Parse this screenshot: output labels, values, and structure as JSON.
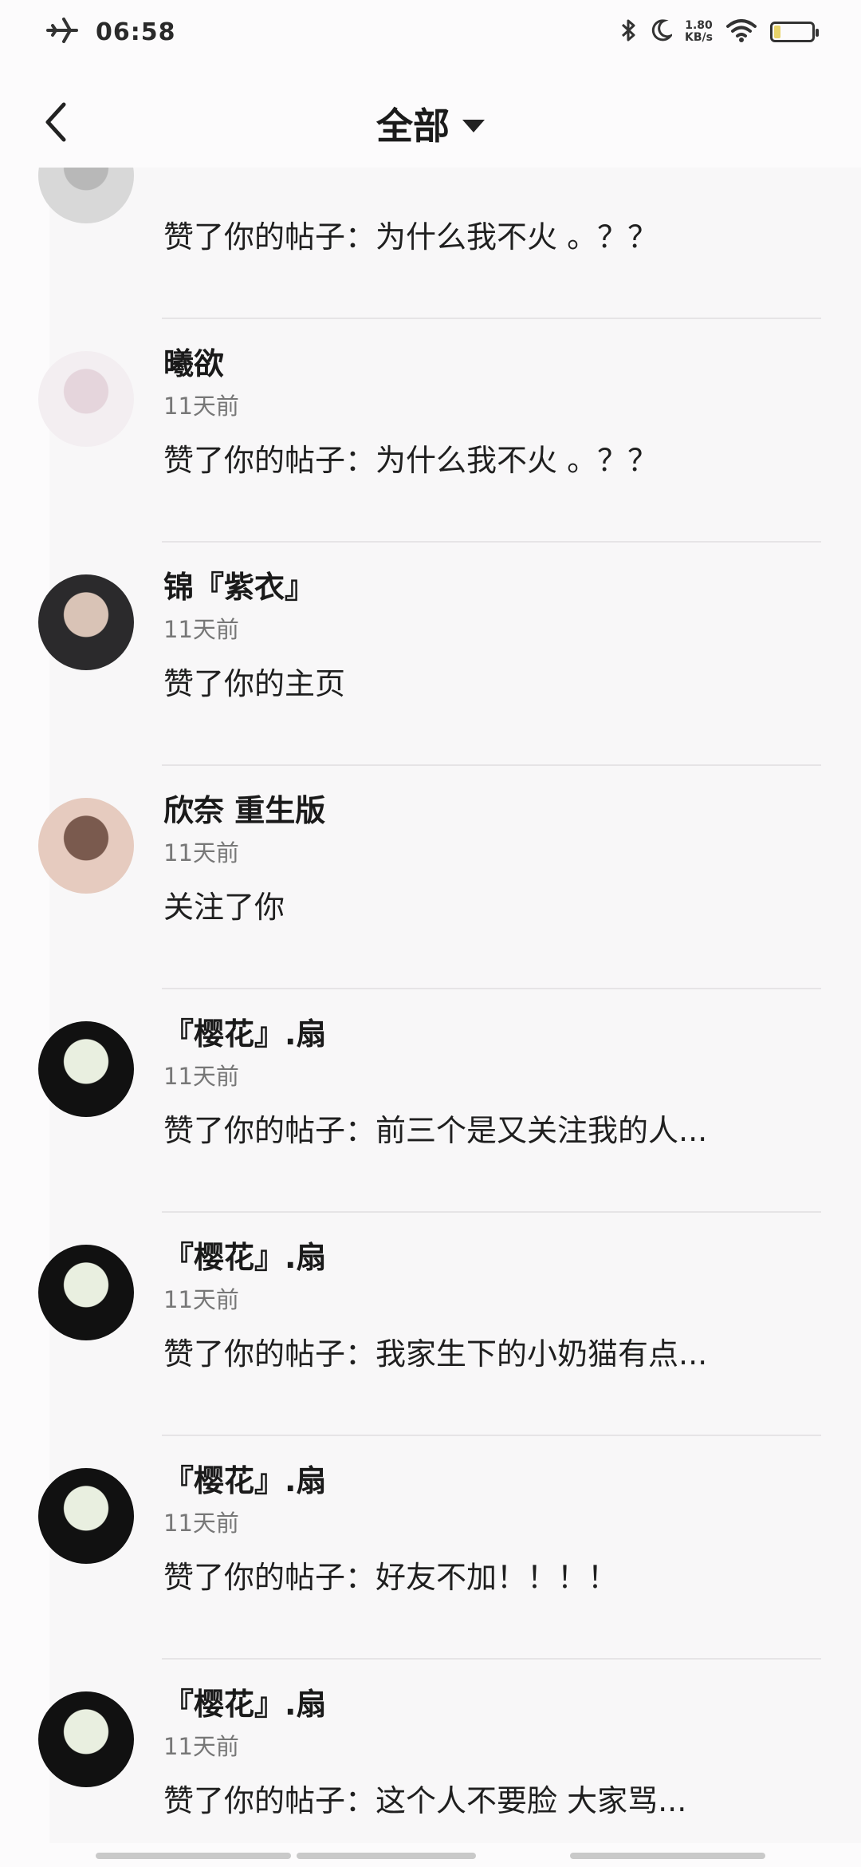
{
  "status_bar": {
    "time": "06:58",
    "net_speed_value": "1.80",
    "net_speed_unit": "KB/s"
  },
  "header": {
    "title": "全部"
  },
  "notifications": [
    {
      "name": "",
      "time": "",
      "action": "赞了你的帖子：为什么我不火 。？？",
      "avatar_palette": [
        "#d8d8d8",
        "#b8b8b8"
      ]
    },
    {
      "name": "曦欲",
      "time": "11天前",
      "action": "赞了你的帖子：为什么我不火 。？？",
      "avatar_palette": [
        "#f3eef1",
        "#e5d5dc"
      ]
    },
    {
      "name": "锦『紫衣』",
      "time": "11天前",
      "action": "赞了你的主页",
      "avatar_palette": [
        "#2b2a2c",
        "#d9c3b6"
      ]
    },
    {
      "name": "欣奈 重生版",
      "time": "11天前",
      "action": "关注了你",
      "avatar_palette": [
        "#e6cbbf",
        "#7a5a4e"
      ]
    },
    {
      "name": "『樱花』.扇",
      "time": "11天前",
      "action": "赞了你的帖子：前三个是又关注我的人...",
      "avatar_palette": [
        "#111111",
        "#e9efe0"
      ]
    },
    {
      "name": "『樱花』.扇",
      "time": "11天前",
      "action": "赞了你的帖子：我家生下的小奶猫有点...",
      "avatar_palette": [
        "#111111",
        "#e9efe0"
      ]
    },
    {
      "name": "『樱花』.扇",
      "time": "11天前",
      "action": "赞了你的帖子：好友不加！！！！",
      "avatar_palette": [
        "#111111",
        "#e9efe0"
      ]
    },
    {
      "name": "『樱花』.扇",
      "time": "11天前",
      "action": "赞了你的帖子：这个人不要脸 大家骂...",
      "avatar_palette": [
        "#111111",
        "#e9efe0"
      ]
    }
  ]
}
